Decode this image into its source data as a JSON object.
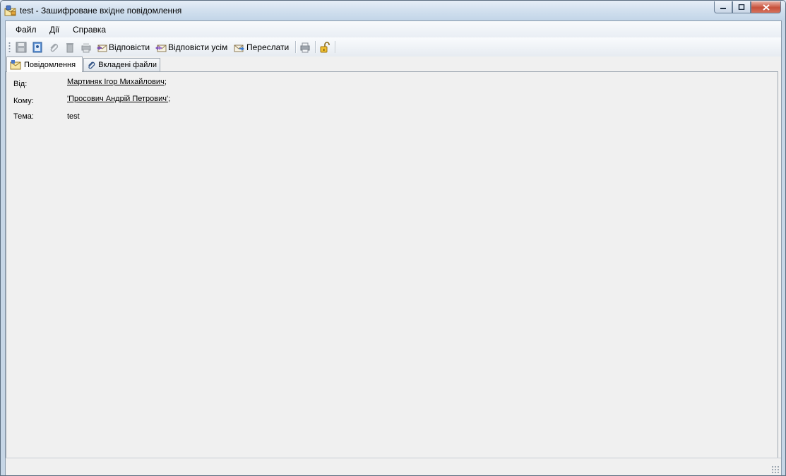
{
  "window": {
    "title": "test - Зашифроване вхідне повідомлення"
  },
  "menu": {
    "file": "Файл",
    "actions": "Дії",
    "help": "Справка"
  },
  "toolbar": {
    "reply": "Відповісти",
    "reply_all": "Відповісти усім",
    "forward": "Переслати",
    "icons": [
      "save-icon",
      "address-book-icon",
      "attach-icon",
      "delete-icon",
      "print-preview-icon",
      "reply-icon",
      "reply-all-icon",
      "forward-icon",
      "print-icon",
      "unlock-icon"
    ]
  },
  "tabs": {
    "message": "Повідомлення",
    "attachments": "Вкладені файли"
  },
  "fields": {
    "from_label": "Від:",
    "from_value": "Мартиняк Ігор Михайлович",
    "from_suffix": ";",
    "to_label": "Кому:",
    "to_value": "'Просович Андрій Петрович'",
    "to_suffix": ";",
    "subject_label": "Тема:",
    "subject_value": "test"
  },
  "colors": {
    "titlebar": "#d3e1ef",
    "client_bg": "#f0f0f0",
    "close_button": "#c7503a"
  }
}
